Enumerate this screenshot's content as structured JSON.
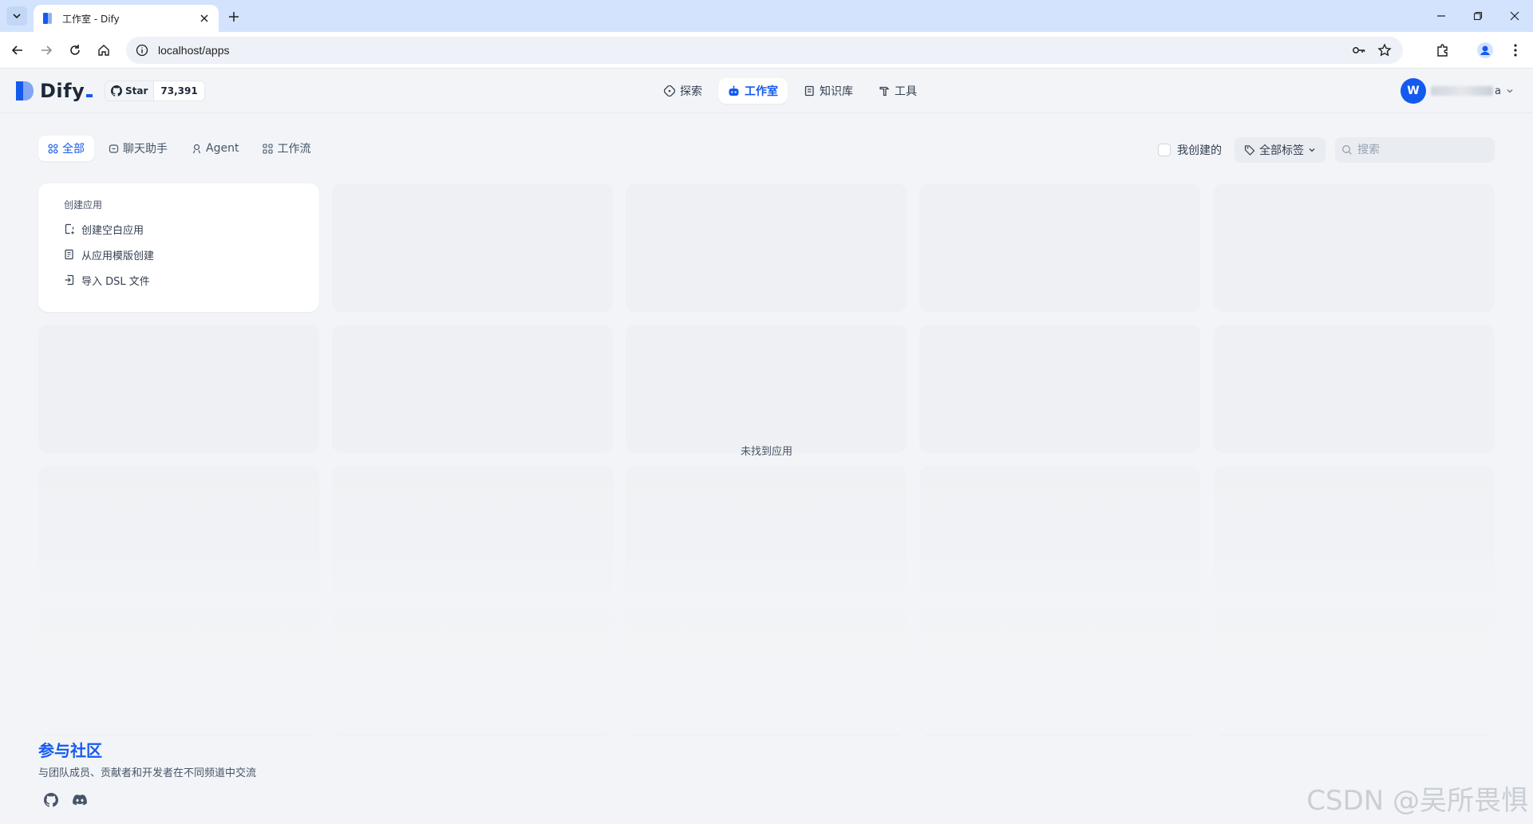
{
  "browser": {
    "tab_title": "工作室 - Dify",
    "url": "localhost/apps"
  },
  "header": {
    "logo_text": "Dify",
    "github_star_label": "Star",
    "github_star_count": "73,391",
    "nav": [
      {
        "label": "探索",
        "icon": "compass-icon"
      },
      {
        "label": "工作室",
        "icon": "robot-icon",
        "active": true
      },
      {
        "label": "知识库",
        "icon": "book-icon"
      },
      {
        "label": "工具",
        "icon": "hammer-icon"
      }
    ],
    "user": {
      "avatar_letter": "W",
      "name_suffix": "a"
    }
  },
  "filters": {
    "tabs": [
      {
        "label": "全部",
        "icon": "grid-icon",
        "active": true
      },
      {
        "label": "聊天助手",
        "icon": "chat-icon"
      },
      {
        "label": "Agent",
        "icon": "agent-icon"
      },
      {
        "label": "工作流",
        "icon": "workflow-icon"
      }
    ],
    "created_by_me": "我创建的",
    "tag_select": "全部标签",
    "search_placeholder": "搜索"
  },
  "create_card": {
    "title": "创建应用",
    "items": [
      {
        "label": "创建空白应用",
        "icon": "file-plus-icon"
      },
      {
        "label": "从应用模版创建",
        "icon": "file-template-icon"
      },
      {
        "label": "导入 DSL 文件",
        "icon": "file-import-icon"
      }
    ]
  },
  "empty_state": "未找到应用",
  "community": {
    "title": "参与社区",
    "description": "与团队成员、贡献者和开发者在不同频道中交流"
  },
  "watermark": "CSDN @吴所畏惧",
  "colors": {
    "accent": "#155aef",
    "background": "#f2f4f7"
  }
}
